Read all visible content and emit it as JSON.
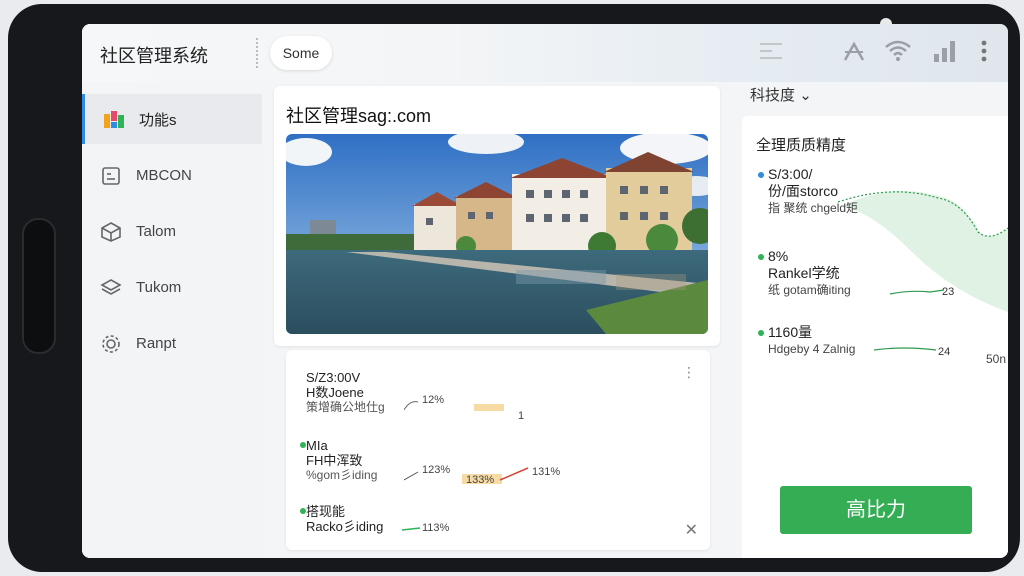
{
  "header": {
    "app_title": "社区管理系统",
    "tab_label": "Some",
    "icons": [
      "list-icon",
      "signal-icon",
      "wifi-icon",
      "bars-icon",
      "more-vertical-icon"
    ]
  },
  "sidebar": {
    "items": [
      {
        "label": "功能s",
        "icon": "app-logo-icon",
        "active": true
      },
      {
        "label": "MBCON",
        "icon": "clipboard-icon",
        "active": false
      },
      {
        "label": "Talom",
        "icon": "cube-icon",
        "active": false
      },
      {
        "label": "Tukom",
        "icon": "layers-icon",
        "active": false
      },
      {
        "label": "Ranpt",
        "icon": "gear-icon",
        "active": false
      }
    ]
  },
  "main": {
    "card_title": "社区管理sag:.com",
    "photo_alt": "lakeside apartment buildings"
  },
  "stats": {
    "rows": [
      {
        "l1": "S/Z3:00V",
        "l2": "H数Joene",
        "l3": "策增确公地仕g",
        "v1": "12%",
        "v2": "1"
      },
      {
        "l1": "MIa",
        "l2": "FH中浑致",
        "l3": "%gom彡iding",
        "v1": "123%",
        "v2": "131%",
        "v3": "133%"
      },
      {
        "l1": "搭现能",
        "l2": "Racko彡iding",
        "l3": "",
        "v1": "113%"
      }
    ]
  },
  "right": {
    "header": "科技度",
    "title": "全理质质精度",
    "rows": [
      {
        "a": "S/3:00/",
        "b": "份/面storco",
        "c": "指 聚统 chgeld矩",
        "n": ""
      },
      {
        "a": "8%",
        "b": "Rankel学统",
        "c": "纸 gotam确iting",
        "n": "23"
      },
      {
        "a": "1160量",
        "b": "",
        "c": "Hdgeby 4 Zalnig",
        "n": "24"
      }
    ],
    "side_value": "50n",
    "cta_label": "高比力"
  },
  "colors": {
    "accent_blue": "#2f8ce0",
    "accent_green": "#35ad55"
  }
}
